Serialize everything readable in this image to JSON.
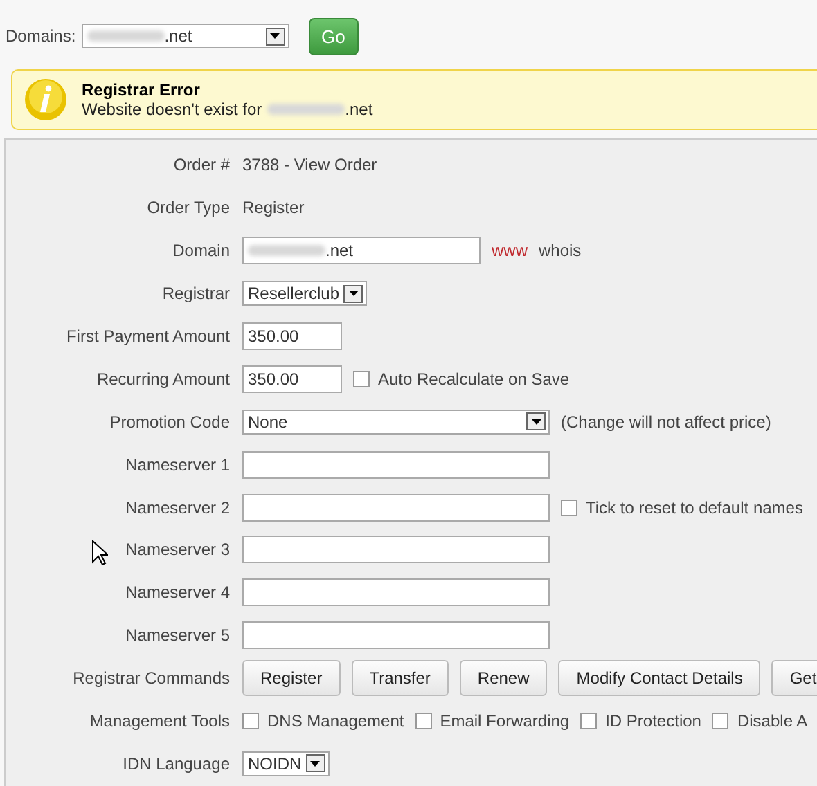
{
  "domains": {
    "label": "Domains:",
    "value": ".net",
    "button": "Go"
  },
  "alert": {
    "title": "Registrar Error",
    "message": "Website doesn't exist for",
    "domain": ".net"
  },
  "form": {
    "rows": [
      {
        "kind": "text",
        "label": "Order #",
        "value": "3788 - View Order"
      },
      {
        "kind": "text",
        "label": "Order Type",
        "value": "Register"
      },
      {
        "kind": "domain",
        "label": "Domain",
        "value": ".net",
        "links": [
          {
            "text": "www",
            "color": "#c0292e"
          },
          {
            "text": "whois",
            "color": "#444444"
          }
        ]
      },
      {
        "kind": "select",
        "label": "Registrar",
        "value": "Resellerclub"
      },
      {
        "kind": "input",
        "label": "First Payment Amount",
        "value": "350.00"
      },
      {
        "kind": "input",
        "label": "Recurring Amount",
        "value": "350.00",
        "checkbox": {
          "label": "Auto Recalculate on Save",
          "checked": false
        }
      },
      {
        "kind": "select",
        "label": "Promotion Code",
        "value": "None",
        "note": "(Change will not affect price)"
      },
      {
        "kind": "input",
        "label": "Nameserver 1",
        "value": ""
      },
      {
        "kind": "input",
        "label": "Nameserver 2",
        "value": "",
        "checkbox": {
          "label": "Tick to reset to default names",
          "checked": false
        }
      },
      {
        "kind": "input",
        "label": "Nameserver 3",
        "value": ""
      },
      {
        "kind": "input",
        "label": "Nameserver 4",
        "value": ""
      },
      {
        "kind": "input",
        "label": "Nameserver 5",
        "value": ""
      },
      {
        "kind": "buttons",
        "label": "Registrar Commands",
        "buttons": [
          "Register",
          "Transfer",
          "Renew",
          "Modify Contact Details",
          "Get"
        ]
      },
      {
        "kind": "checks",
        "label": "Management Tools",
        "checks": [
          {
            "label": "DNS Management",
            "checked": false
          },
          {
            "label": "Email Forwarding",
            "checked": false
          },
          {
            "label": "ID Protection",
            "checked": false
          },
          {
            "label": "Disable A",
            "checked": false
          }
        ]
      },
      {
        "kind": "select",
        "label": "IDN Language",
        "value": "NOIDN"
      }
    ]
  }
}
